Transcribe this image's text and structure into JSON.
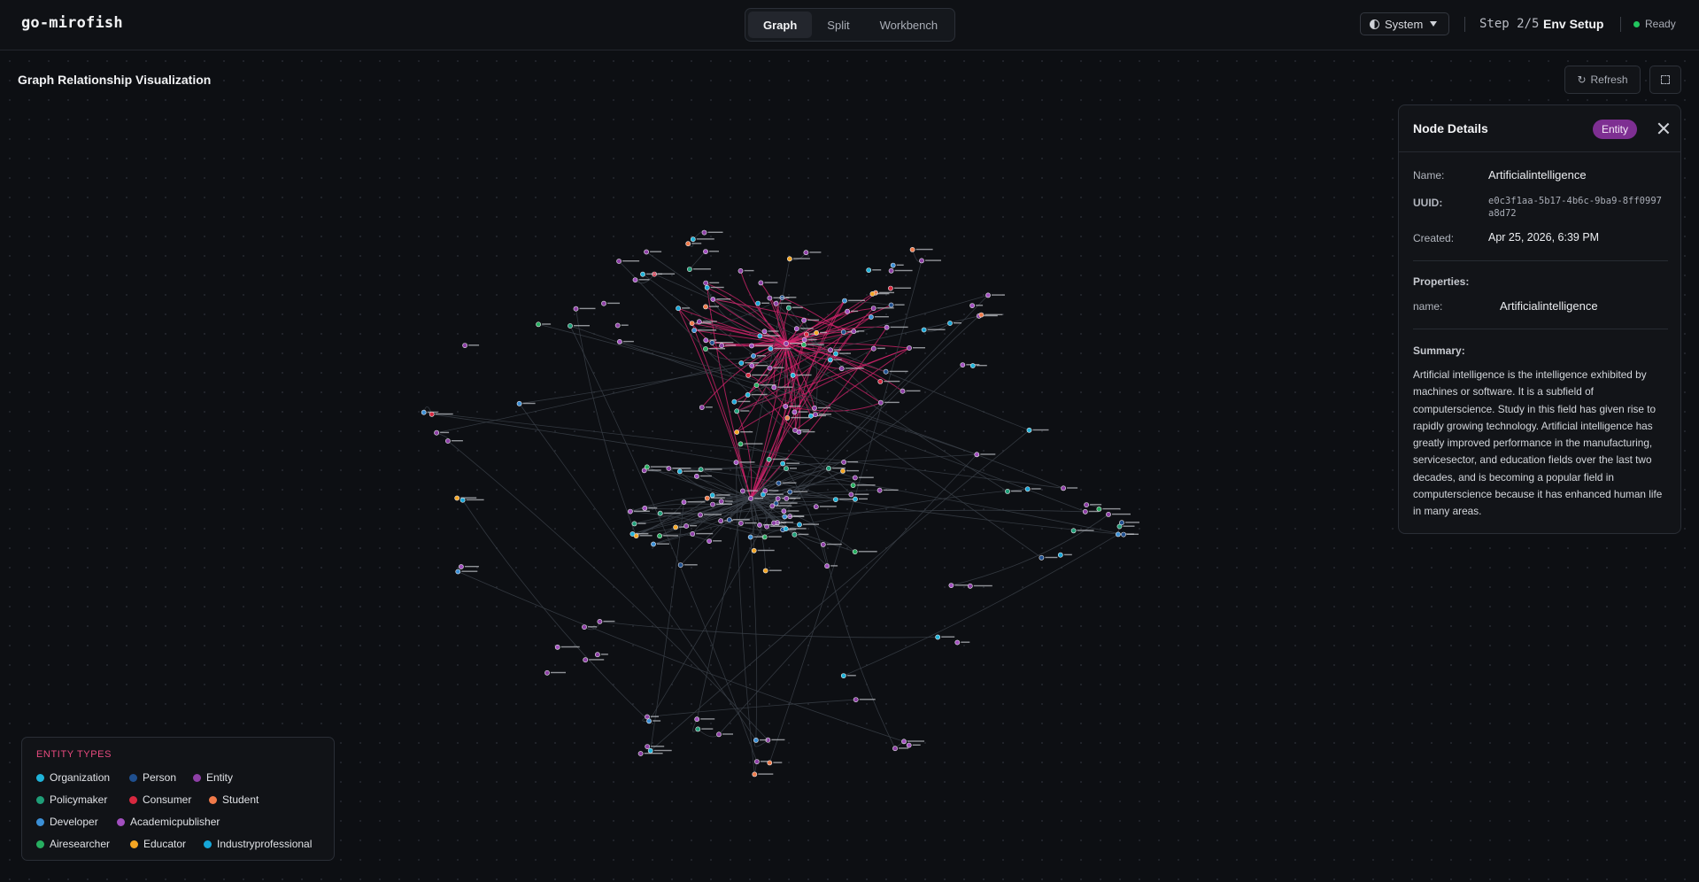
{
  "header": {
    "brand": "go-mirofish",
    "tabs": [
      {
        "label": "Graph",
        "active": true
      },
      {
        "label": "Split",
        "active": false
      },
      {
        "label": "Workbench",
        "active": false
      }
    ],
    "theme": {
      "label": "System",
      "icon": "half-circle-icon"
    },
    "step": {
      "counter": "Step 2/5",
      "name": "Env Setup"
    },
    "status": {
      "label": "Ready",
      "color": "#22c55e"
    }
  },
  "canvas": {
    "title": "Graph Relationship Visualization",
    "refresh_label": "Refresh",
    "accent_edge_color": "#d6246e",
    "edge_color": "#3a3f48"
  },
  "details": {
    "title": "Node Details",
    "badge": "Entity",
    "badge_color": "#7e2f92",
    "fields": {
      "name_label": "Name:",
      "name_value": "Artificialintelligence",
      "uuid_label": "UUID:",
      "uuid_value": "e0c3f1aa-5b17-4b6c-9ba9-8ff0997a8d72",
      "created_label": "Created:",
      "created_value": "Apr 25, 2026, 6:39 PM"
    },
    "properties_label": "Properties:",
    "property": {
      "key": "name:",
      "value": "Artificialintelligence"
    },
    "summary_label": "Summary:",
    "summary": "Artificial intelligence is the intelligence exhibited by machines or software. It is a subfield of computerscience. Study in this field has given rise to rapidly growing technology. Artificial intelligence has greatly improved performance in the manufacturing, servicesector, and education fields over the last two decades, and is becoming a popular field in computerscience because it has enhanced human life in many areas."
  },
  "legend": {
    "title": "ENTITY TYPES",
    "items": [
      {
        "label": "Organization",
        "color": "#1fb3d9"
      },
      {
        "label": "Person",
        "color": "#1f4f8f"
      },
      {
        "label": "Entity",
        "color": "#8e3fa6"
      },
      {
        "label": "Policymaker",
        "color": "#1f9e78"
      },
      {
        "label": "Consumer",
        "color": "#d8283f"
      },
      {
        "label": "Student",
        "color": "#f07a4a"
      },
      {
        "label": "Developer",
        "color": "#3b8fd6"
      },
      {
        "label": "Academicpublisher",
        "color": "#a24fbf"
      },
      {
        "label": "Airesearcher",
        "color": "#27ae60"
      },
      {
        "label": "Educator",
        "color": "#f5a623"
      },
      {
        "label": "Industryprofessional",
        "color": "#16a6d8"
      }
    ]
  }
}
